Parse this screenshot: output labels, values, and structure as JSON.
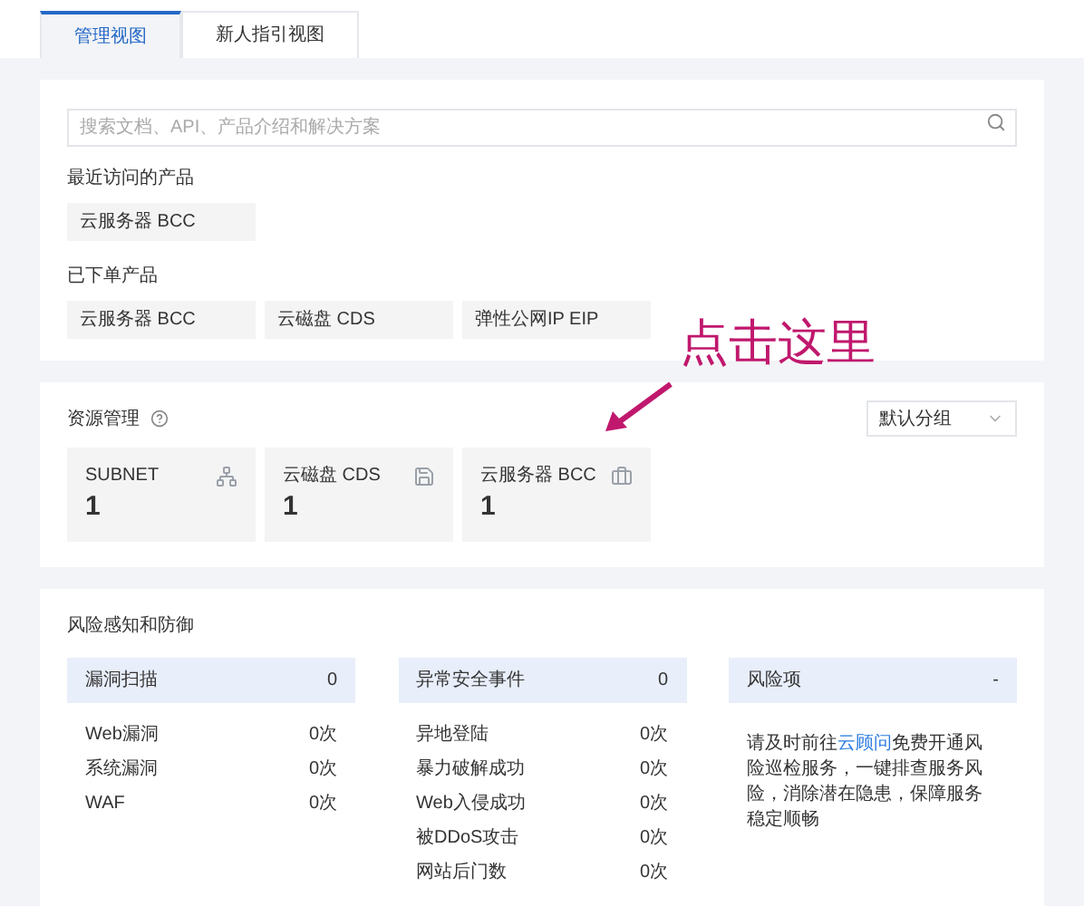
{
  "tabs": [
    {
      "label": "管理视图",
      "selected": true
    },
    {
      "label": "新人指引视图",
      "selected": false
    }
  ],
  "search": {
    "placeholder": "搜索文档、API、产品介绍和解决方案"
  },
  "recent": {
    "title": "最近访问的产品",
    "items": [
      "云服务器 BCC"
    ]
  },
  "ordered": {
    "title": "已下单产品",
    "items": [
      "云服务器 BCC",
      "云磁盘 CDS",
      "弹性公网IP EIP"
    ]
  },
  "annotation": {
    "text": "点击这里"
  },
  "resources": {
    "title": "资源管理",
    "group_select": "默认分组",
    "cards": [
      {
        "name": "SUBNET",
        "count": "1",
        "kind": "network"
      },
      {
        "name": "云磁盘 CDS",
        "count": "1",
        "kind": "disk"
      },
      {
        "name": "云服务器 BCC",
        "count": "1",
        "kind": "server"
      }
    ]
  },
  "risk": {
    "title": "风险感知和防御",
    "columns": [
      {
        "title": "漏洞扫描",
        "value": "0",
        "rows": [
          {
            "label": "Web漏洞",
            "value": "0次"
          },
          {
            "label": "系统漏洞",
            "value": "0次"
          },
          {
            "label": "WAF",
            "value": "0次"
          }
        ]
      },
      {
        "title": "异常安全事件",
        "value": "0",
        "rows": [
          {
            "label": "异地登陆",
            "value": "0次"
          },
          {
            "label": "暴力破解成功",
            "value": "0次"
          },
          {
            "label": "Web入侵成功",
            "value": "0次"
          },
          {
            "label": "被DDoS攻击",
            "value": "0次"
          },
          {
            "label": "网站后门数",
            "value": "0次"
          }
        ]
      },
      {
        "title": "风险项",
        "value": "-",
        "note_before": "请及时前往",
        "note_link": "云顾问",
        "note_after": "免费开通风险巡检服务，一键排查服务风险，消除潜在隐患，保障服务稳定顺畅"
      }
    ]
  }
}
